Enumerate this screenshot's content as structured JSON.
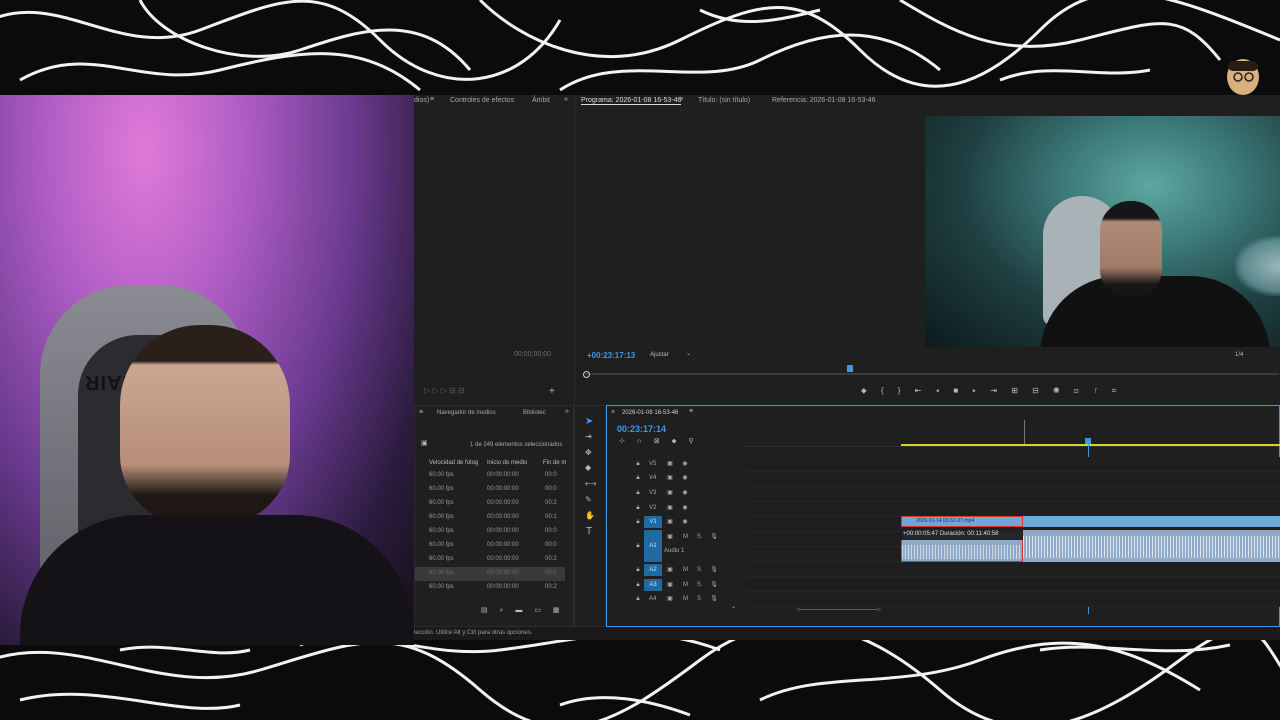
{
  "colors": {
    "accent": "#3d98ea",
    "playhead": "#3d98ea",
    "clip_video": "#6fa7d8",
    "clip_audio": "#8fa9c7",
    "work_area": "#d9d21f"
  },
  "source_panel": {
    "tabs": [
      "dios)",
      "Controles de efectos",
      "Ámbit"
    ],
    "timecode": "00;00;00;00"
  },
  "program_panel": {
    "tabs": [
      "Programa: 2026-01-08 16-53-46",
      "Título: (sin título)",
      "Referencia: 2026-01-08 16-53-46"
    ],
    "timecode": "+00:23:17:13",
    "fit_label": "Ajustar",
    "page": "1/4"
  },
  "project_panel": {
    "tabs": [
      "Navegador de medios",
      "Bibliotec"
    ],
    "selection_info": "1 de 249 elementos seleccionados",
    "columns": [
      "Velocidad de fotog",
      "Inicio de medio",
      "Fin de m"
    ],
    "rows": [
      [
        "60.00 fps",
        "00:00:00:00",
        "00:0"
      ],
      [
        "60.00 fps",
        "00:00:00:00",
        "00:0"
      ],
      [
        "60.00 fps",
        "00:00:00:00",
        "00:2"
      ],
      [
        "60.00 fps",
        "00:00:00:00",
        "00:1"
      ],
      [
        "60.00 fps",
        "00:00:00:00",
        "00:0"
      ],
      [
        "60.00 fps",
        "00:00:00:00",
        "00:0"
      ],
      [
        "60.00 fps",
        "00:00:00:00",
        "00:2"
      ],
      [
        "60.00 fps",
        "00:00:00:00",
        "00:0"
      ],
      [
        "60.00 fps",
        "00:00:00:00",
        "00:2"
      ]
    ]
  },
  "timeline": {
    "tab": "2026-01-08 16-53-46",
    "timecode": "00:23:17:14",
    "video_tracks": [
      "V5",
      "V4",
      "V3",
      "V2",
      "V1"
    ],
    "audio_tracks": [
      "A1",
      "A2",
      "A3",
      "A4"
    ],
    "audio_name": "Audio 1",
    "clip_name": "2026-01-14 03-52-37.mp4",
    "tooltip": "+00:00:05:47 Duración: 00:11:40:58"
  },
  "status_bar": {
    "text": "lección. Utilice Alt y Ctrl para otras opciones."
  },
  "webcam": {
    "chair_text": "RIAIR"
  }
}
